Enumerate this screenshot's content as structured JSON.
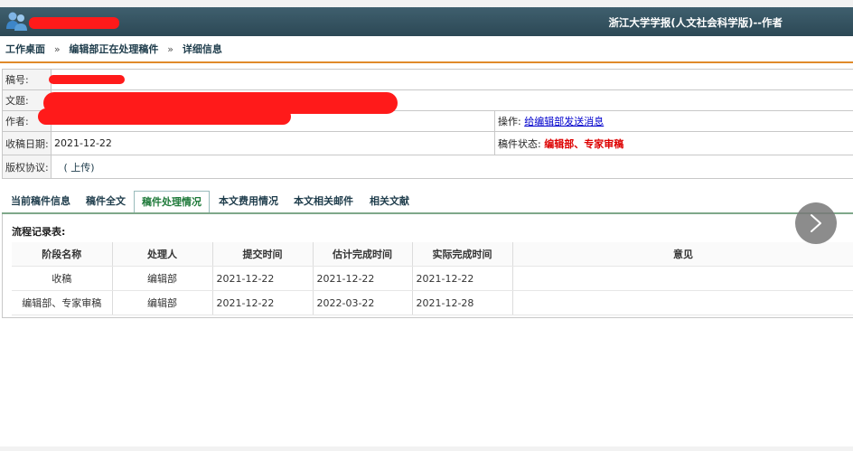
{
  "header": {
    "app_title": "浙江大学学报(人文社会科学版)--作者",
    "logo_icon": "users-icon"
  },
  "breadcrumb": [
    "工作桌面",
    "编辑部正在处理稿件",
    "详细信息"
  ],
  "manuscript": {
    "id_label": "稿号:",
    "title_label": "文题:",
    "author_label": "作者:",
    "operation_label": "操作:",
    "operation_link": "给编辑部发送消息",
    "received_label": "收稿日期:",
    "received_value": "2021-12-22",
    "status_label": "稿件状态:",
    "status_value": "编辑部、专家审稿",
    "copyright_label": "版权协议:",
    "copyright_value": "( 上传)"
  },
  "tabs": [
    {
      "label": "当前稿件信息",
      "active": false
    },
    {
      "label": "稿件全文",
      "active": false
    },
    {
      "label": "稿件处理情况",
      "active": true
    },
    {
      "label": "本文费用情况",
      "active": false
    },
    {
      "label": "本文相关邮件",
      "active": false
    },
    {
      "label": "相关文献",
      "active": false
    }
  ],
  "flow": {
    "title": "流程记录表:",
    "columns": [
      "阶段名称",
      "处理人",
      "提交时间",
      "估计完成时间",
      "实际完成时间",
      "意见"
    ],
    "rows": [
      [
        "收稿",
        "编辑部",
        "2021-12-22",
        "2021-12-22",
        "2021-12-22",
        ""
      ],
      [
        "编辑部、专家审稿",
        "编辑部",
        "2021-12-22",
        "2022-03-22",
        "2021-12-28",
        ""
      ]
    ]
  },
  "colors": {
    "header_bg": "#2c4855",
    "accent_orange": "#e08a2a",
    "status_red": "#dd0000",
    "link_blue": "#0000cc",
    "redaction": "#ff1a1a"
  },
  "next_button_icon": "chevron-right-icon"
}
